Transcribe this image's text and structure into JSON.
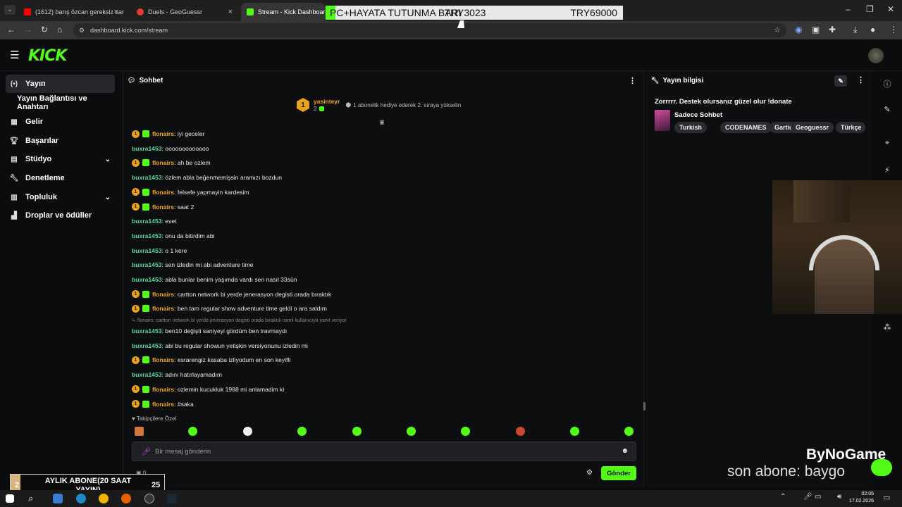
{
  "browser": {
    "tabs": [
      {
        "label": "(1612) barış özcan gereksiz san",
        "color": "#ff0000"
      },
      {
        "label": "Duels - GeoGuessr",
        "color": "#e53935"
      },
      {
        "label": "Stream - Kick Dashboard",
        "color": "#53fc18"
      }
    ],
    "url": "dashboard.kick.com/stream",
    "banner_left": "PC+HAYATA TUTUNMA BARI",
    "banner_mid": "TRY3023",
    "banner_right": "TRY69000"
  },
  "sidebar": {
    "items": [
      {
        "label": "Yayın",
        "icon": "broadcast-icon"
      },
      {
        "label": "Yayın Bağlantısı ve Anahtarı",
        "icon": ""
      },
      {
        "label": "Gelir",
        "icon": "revenue-icon"
      },
      {
        "label": "Başarılar",
        "icon": "trophy-icon"
      },
      {
        "label": "Stüdyo",
        "icon": "studio-icon"
      },
      {
        "label": "Denetleme",
        "icon": "wrench-icon"
      },
      {
        "label": "Topluluk",
        "icon": "community-icon"
      },
      {
        "label": "Droplar ve ödüller",
        "icon": "gift-icon"
      }
    ]
  },
  "chat": {
    "title": "Sohbet",
    "pinned_user": "yasinteyr",
    "pinned_count": "2",
    "pinned_text": "1 abonelik hediye ederek 2. sıraya yükselin",
    "messages": [
      {
        "user": "flonairs",
        "text": "iyi geceler",
        "sub": true
      },
      {
        "user": "buxra1453",
        "text": "ooooooooooooo",
        "sub": false
      },
      {
        "user": "flonairs",
        "text": "ah be ozlem",
        "sub": true
      },
      {
        "user": "buxra1453",
        "text": "özlem abla beğenmemişsin aramızı bozdun",
        "sub": false
      },
      {
        "user": "flonairs",
        "text": "felsefe yapmayin kardesim",
        "sub": true
      },
      {
        "user": "flonairs",
        "text": "saat 2",
        "sub": true
      },
      {
        "user": "buxra1453",
        "text": "evet",
        "sub": false
      },
      {
        "user": "buxra1453",
        "text": "onu da bitirdim abi",
        "sub": false
      },
      {
        "user": "buxra1453",
        "text": "o 1 kere",
        "sub": false
      },
      {
        "user": "buxra1453",
        "text": "sen izledin mi abi adventure time",
        "sub": false
      },
      {
        "user": "buxra1453",
        "text": "abla bunlar benim yaşımda vardı sen nasıl 33sün",
        "sub": false
      },
      {
        "user": "flonairs",
        "text": "cartton network bi yerde jenerasyon degisti orada bıraktık",
        "sub": true
      },
      {
        "user": "flonairs",
        "text": "ben tam regular show adventure time geldi o ara saldım",
        "sub": true
      }
    ],
    "reply_hint": "flonairs: cartton network bi yerde jenerasyon degisti orada bıraktık isimli kullanıcıya yanıt veriyor",
    "messages2": [
      {
        "user": "buxra1453",
        "text": "ben10 değişti saniyeyi gördüm ben travmaydı",
        "sub": false
      },
      {
        "user": "buxra1453",
        "text": "abi bu regular showun yetişkin versiyonunu izledin mi",
        "sub": false
      },
      {
        "user": "flonairs",
        "text": "esrarengiz kasaba izliyodum en son keyifli",
        "sub": true
      },
      {
        "user": "buxra1453",
        "text": "adını hatırlayamadım",
        "sub": false
      },
      {
        "user": "flonairs",
        "text": "ozlemin kucukluk 1988 mi anlamadim ki",
        "sub": true
      },
      {
        "user": "flonairs",
        "text": "#saka",
        "sub": true
      }
    ],
    "emote_section": "Takipçilere Özel",
    "input_placeholder": "Bir mesaj gönderin",
    "send_label": "Gönder",
    "gift_count": "0"
  },
  "info": {
    "title": "Yayın bilgisi",
    "stream_title": "Zorrrrr. Destek olursanız güzel olur !donate",
    "category": "Sadece Sohbet",
    "tags": [
      "Turkish",
      "CODENAMES",
      "Gartic",
      "Geoguessr",
      "Türkçe"
    ]
  },
  "overlay": {
    "sub_goal_left": "2",
    "sub_goal_label": "AYLIK ABONE(20 SAAT YAYIN)",
    "sub_goal_right": "25",
    "last_sub": "son abone: baygo",
    "brand": "ByNoGame"
  },
  "taskbar": {
    "time": "02:05",
    "date": "17.02.2026"
  }
}
